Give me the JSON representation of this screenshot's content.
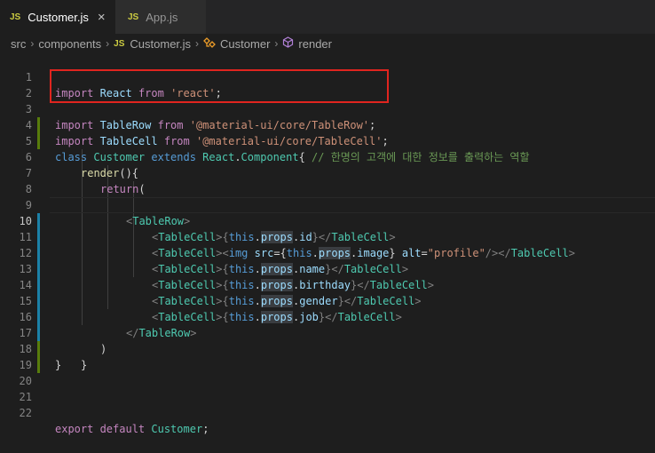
{
  "tabs": [
    {
      "label": "Customer.js",
      "badge": "JS",
      "active": true
    },
    {
      "label": "App.js",
      "badge": "JS",
      "active": false
    }
  ],
  "breadcrumb": {
    "items": [
      "src",
      "components",
      "Customer.js",
      "Customer",
      "render"
    ],
    "js_badge": "JS"
  },
  "editor": {
    "current_line": 10,
    "line_numbers": [
      "1",
      "2",
      "3",
      "4",
      "5",
      "6",
      "7",
      "8",
      "9",
      "10",
      "11",
      "12",
      "13",
      "14",
      "15",
      "16",
      "17",
      "18",
      "19",
      "20",
      "21",
      "22"
    ],
    "lines": {
      "l1": [
        "import",
        " React ",
        "from",
        " 'react'",
        ";"
      ],
      "l2": [
        "import",
        " TableRow ",
        "from",
        " '@material-ui/core/TableRow'",
        ";"
      ],
      "l3": [
        "import",
        " TableCell ",
        "from",
        " '@material-ui/core/TableCell'",
        ";"
      ],
      "l5": [
        "class",
        " Customer ",
        "extends",
        " React",
        ".",
        "Component",
        "{ ",
        "// 한명의 고객에 대한 정보를 출력하는 역할"
      ],
      "l6": [
        "render",
        "(){"
      ],
      "l7": [
        "return",
        "("
      ],
      "l8": [
        "<",
        "TableRow",
        ">"
      ],
      "l9": [
        "<",
        "TableCell",
        ">{",
        "this",
        ".",
        "props",
        ".",
        "id",
        "}</",
        "TableCell",
        ">"
      ],
      "l10": [
        "<",
        "TableCell",
        "><",
        "img",
        " src",
        "={",
        "this",
        ".",
        "props",
        ".",
        "image",
        "} ",
        "alt",
        "=",
        "\"profile\"",
        "/></",
        "TableCell",
        ">"
      ],
      "l11": [
        "<",
        "TableCell",
        ">{",
        "this",
        ".",
        "props",
        ".",
        "name",
        "}</",
        "TableCell",
        ">"
      ],
      "l12": [
        "<",
        "TableCell",
        ">{",
        "this",
        ".",
        "props",
        ".",
        "birthday",
        "}</",
        "TableCell",
        ">"
      ],
      "l13": [
        "<",
        "TableCell",
        ">{",
        "this",
        ".",
        "props",
        ".",
        "gender",
        "}</",
        "TableCell",
        ">"
      ],
      "l14": [
        "<",
        "TableCell",
        ">{",
        "this",
        ".",
        "props",
        ".",
        "job",
        "}</",
        "TableCell",
        ">"
      ],
      "l15": [
        "</",
        "TableRow",
        ">"
      ],
      "l16": [
        ")"
      ],
      "l17": [
        "}"
      ],
      "l18": [
        "}"
      ],
      "l22": [
        "export",
        " default",
        " Customer",
        ";"
      ]
    }
  }
}
